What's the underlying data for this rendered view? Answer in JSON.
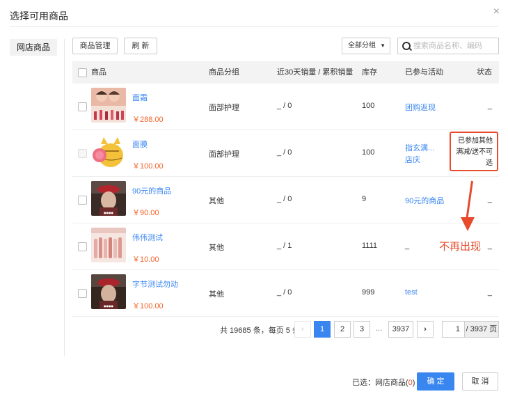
{
  "dialog": {
    "title": "选择可用商品",
    "close_label": "×"
  },
  "side": {
    "tab_label": "网店商品"
  },
  "toolbar": {
    "manage_label": "商品管理",
    "refresh_label": "刷 新",
    "group_select_value": "全部分组",
    "search_placeholder": "搜索商品名称、编码"
  },
  "table": {
    "headers": [
      "商品",
      "商品分组",
      "近30天销量 / 累积销量",
      "库存",
      "已参与活动",
      "状态"
    ],
    "rows": [
      {
        "name": "面霜",
        "price": "￥288.00",
        "group": "面部护理",
        "sales": "_ / 0",
        "stock": "100",
        "activity": "团购返现",
        "status": "_"
      },
      {
        "name": "面膜",
        "price": "￥100.00",
        "group": "面部护理",
        "sales": "_ / 0",
        "stock": "100",
        "activity_line1": "指玄满...",
        "activity_line2": "店庆",
        "status": ""
      },
      {
        "name": "90元的商品",
        "price": "￥90.00",
        "group": "其他",
        "sales": "_ / 0",
        "stock": "9",
        "activity": "90元的商品",
        "status": "_"
      },
      {
        "name": "伟伟测试",
        "price": "￥10.00",
        "group": "其他",
        "sales": "_ / 1",
        "stock": "1111",
        "activity": "_",
        "status": "_"
      },
      {
        "name": "字节测试勿动",
        "price": "￥100.00",
        "group": "其他",
        "sales": "_ / 0",
        "stock": "999",
        "activity": "test",
        "status": "_"
      }
    ]
  },
  "annotation": {
    "tooltip_line1": "已参加其他",
    "tooltip_line2": "满减/送不可",
    "tooltip_line3": "选",
    "note": "不再出现"
  },
  "pagination": {
    "summary": "共 19685 条，每页 5 条",
    "prev": "‹",
    "pages": [
      "1",
      "2",
      "3"
    ],
    "ellipsis": "...",
    "last_page": "3937",
    "next": "›",
    "current_input": "1",
    "total_label": "/ 3937 页"
  },
  "footer": {
    "selected_prefix": "已选：网店商品(",
    "selected_count": "0",
    "selected_suffix": ")",
    "ok_label": "确 定",
    "cancel_label": "取 消"
  },
  "colors": {
    "accent": "#3a86f0",
    "price": "#f0642a",
    "annotation": "#e74a2c"
  }
}
